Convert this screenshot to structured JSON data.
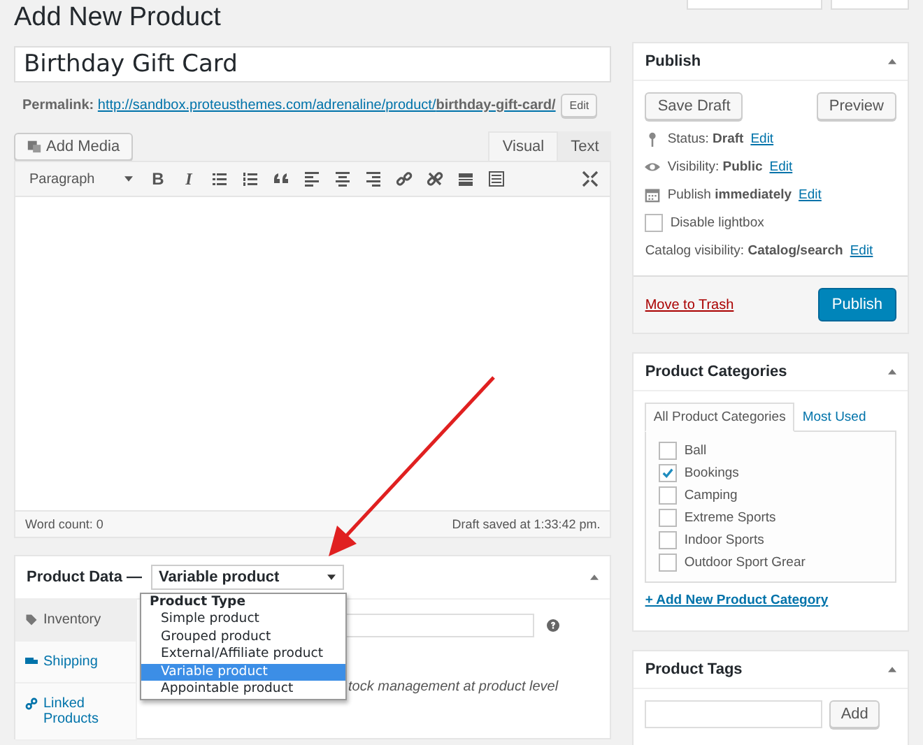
{
  "page_title": "Add New Product",
  "title_field": {
    "value": "Birthday Gift Card"
  },
  "permalink": {
    "label": "Permalink:",
    "url": "http://sandbox.proteusthemes.com/adrenaline/product/",
    "slug": "birthday-gift-card/",
    "edit": "Edit"
  },
  "editor": {
    "add_media": "Add Media",
    "tabs": [
      {
        "label": "Visual",
        "selected": true
      },
      {
        "label": "Text",
        "selected": false
      }
    ],
    "format": "Paragraph",
    "toolbar": [
      {
        "kind": "bold",
        "label": "B"
      },
      {
        "kind": "italic",
        "label": "I"
      },
      {
        "kind": "bullets"
      },
      {
        "kind": "numbers"
      },
      {
        "kind": "quote"
      },
      {
        "kind": "align-left"
      },
      {
        "kind": "align-center"
      },
      {
        "kind": "align-right"
      },
      {
        "kind": "link"
      },
      {
        "kind": "unlink"
      },
      {
        "kind": "more"
      },
      {
        "kind": "kitchen"
      }
    ],
    "word_count": "Word count: 0",
    "saved": "Draft saved at 1:33:42 pm."
  },
  "product_data": {
    "title": "Product Data —",
    "select": "Variable product",
    "dropdown": {
      "group": "Product Type",
      "options": [
        {
          "label": "Simple product",
          "selected": false
        },
        {
          "label": "Grouped product",
          "selected": false
        },
        {
          "label": "External/Affiliate product",
          "selected": false
        },
        {
          "label": "Variable product",
          "selected": true
        },
        {
          "label": "Appointable product",
          "selected": false
        }
      ]
    },
    "tabs": [
      {
        "kind": "inventory",
        "label": "Inventory",
        "selected": true
      },
      {
        "kind": "shipping",
        "label": "Shipping",
        "selected": false
      },
      {
        "kind": "linked",
        "label": "Linked Products",
        "selected": false
      }
    ],
    "note": "tock management at product level"
  },
  "publish": {
    "title": "Publish",
    "save_draft": "Save Draft",
    "preview": "Preview",
    "rows": [
      {
        "kind": "status",
        "text": "Status: **Draft**",
        "link": "Edit"
      },
      {
        "kind": "visibility",
        "text": "Visibility: **Public**",
        "link": "Edit"
      },
      {
        "kind": "schedule",
        "text": "Publish **immediately**",
        "link": "Edit"
      }
    ],
    "checkbox": {
      "label": "Disable lightbox",
      "checked": false
    },
    "catalog": {
      "text": "Catalog visibility: **Catalog/search**",
      "link": "Edit"
    },
    "trash": "Move to Trash",
    "publish": "Publish"
  },
  "categories": {
    "title": "Product Categories",
    "tabs": [
      {
        "label": "All Product Categories",
        "selected": true
      },
      {
        "label": "Most Used",
        "selected": false
      }
    ],
    "items": [
      {
        "label": "Ball",
        "checked": false
      },
      {
        "label": "Bookings",
        "checked": true
      },
      {
        "label": "Camping",
        "checked": false
      },
      {
        "label": "Extreme Sports",
        "checked": false
      },
      {
        "label": "Indoor Sports",
        "checked": false
      },
      {
        "label": "Outdoor Sport Grear",
        "checked": false
      }
    ],
    "add_link": "+ Add New Product Category"
  },
  "tags": {
    "title": "Product Tags",
    "add": "Add"
  }
}
